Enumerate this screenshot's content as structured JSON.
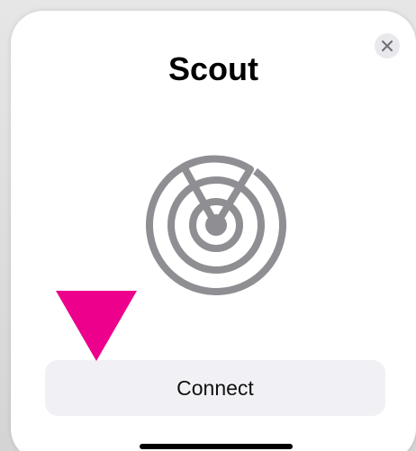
{
  "dialog": {
    "title": "Scout",
    "close_icon": "close-icon",
    "radar_icon": "radar-icon",
    "connect_label": "Connect"
  },
  "colors": {
    "sheet_background": "#ffffff",
    "icon_gray": "#8e8e93",
    "button_background": "#f1f1f5",
    "close_background": "#e8e8ed",
    "marker_magenta": "#ec008c"
  }
}
